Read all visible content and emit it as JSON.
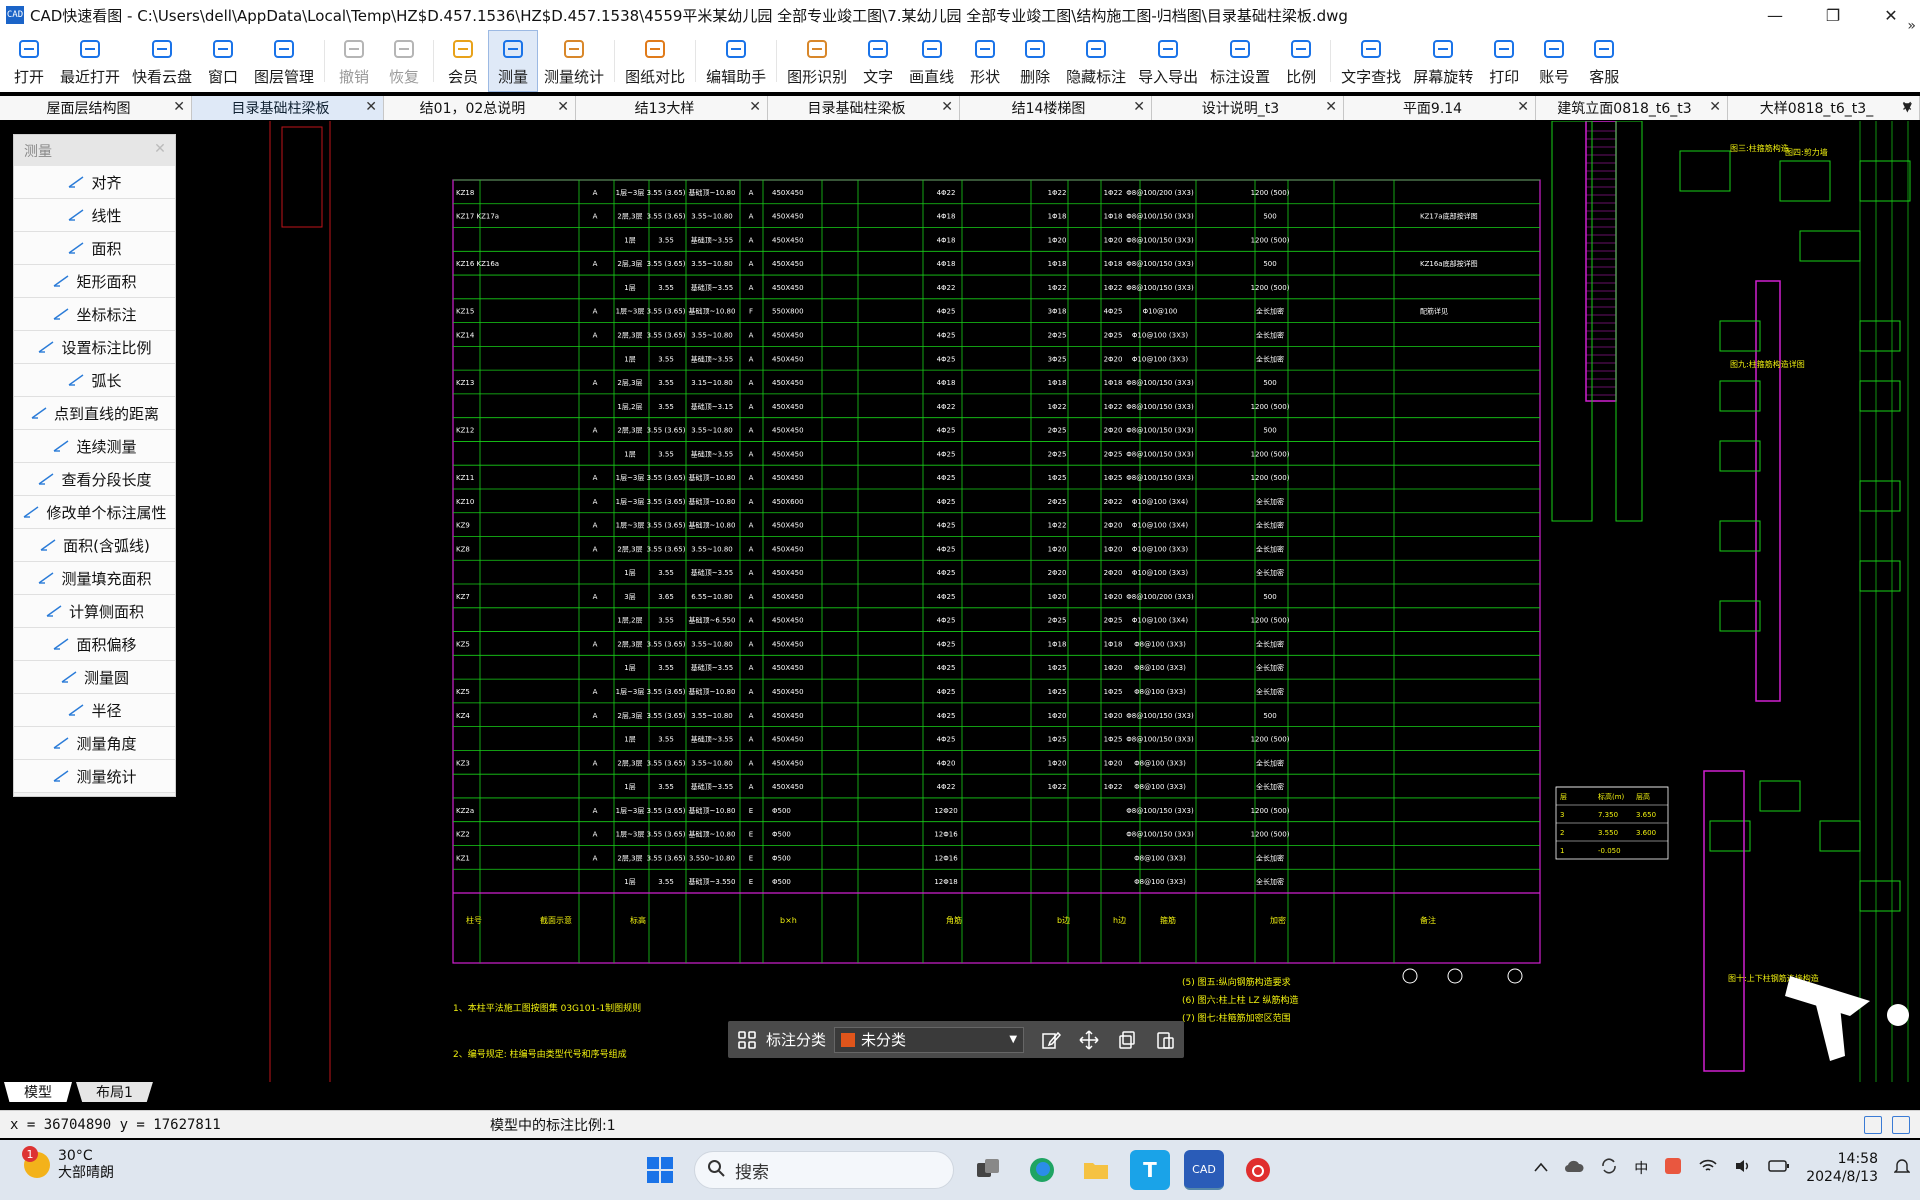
{
  "window": {
    "title": "CAD快速看图 - C:\\Users\\dell\\AppData\\Local\\Temp\\HZ$D.457.1536\\HZ$D.457.1538\\4559平米某幼儿园 全部专业竣工图\\7.某幼儿园 全部专业竣工图\\结构施工图-归档图\\目录基础柱梁板.dwg",
    "app_icon_text": "CAD",
    "controls": {
      "minimize": "—",
      "restore": "❐",
      "close": "✕"
    }
  },
  "toolbar": {
    "items": [
      {
        "label": "打开",
        "icon": "folder-open-icon",
        "state": "normal"
      },
      {
        "label": "最近打开",
        "icon": "recent-clock-icon",
        "state": "normal"
      },
      {
        "label": "快看云盘",
        "icon": "cloud-icon",
        "state": "normal"
      },
      {
        "label": "窗口",
        "icon": "window-icon",
        "state": "normal"
      },
      {
        "label": "图层管理",
        "icon": "layers-icon",
        "state": "normal"
      },
      {
        "label": "撤销",
        "icon": "undo-icon",
        "state": "disabled"
      },
      {
        "label": "恢复",
        "icon": "redo-icon",
        "state": "disabled"
      },
      {
        "label": "会员",
        "icon": "vip-icon",
        "state": "normal"
      },
      {
        "label": "测量",
        "icon": "ruler-icon",
        "state": "active"
      },
      {
        "label": "测量统计",
        "icon": "measure-stats-icon",
        "state": "normal"
      },
      {
        "label": "图纸对比",
        "icon": "compare-icon",
        "state": "normal"
      },
      {
        "label": "编辑助手",
        "icon": "cad-edit-icon",
        "state": "normal"
      },
      {
        "label": "图形识别",
        "icon": "shape-recognize-icon",
        "state": "normal"
      },
      {
        "label": "文字",
        "icon": "text-icon",
        "state": "normal"
      },
      {
        "label": "画直线",
        "icon": "line-icon",
        "state": "normal"
      },
      {
        "label": "形状",
        "icon": "shape-icon",
        "state": "normal"
      },
      {
        "label": "删除",
        "icon": "eraser-icon",
        "state": "normal"
      },
      {
        "label": "隐藏标注",
        "icon": "hide-eye-icon",
        "state": "normal"
      },
      {
        "label": "导入导出",
        "icon": "import-export-icon",
        "state": "normal"
      },
      {
        "label": "标注设置",
        "icon": "annotation-settings-icon",
        "state": "normal"
      },
      {
        "label": "比例",
        "icon": "scale-icon",
        "state": "normal"
      },
      {
        "label": "文字查找",
        "icon": "text-search-icon",
        "state": "normal"
      },
      {
        "label": "屏幕旋转",
        "icon": "rotate-screen-icon",
        "state": "normal"
      },
      {
        "label": "打印",
        "icon": "print-icon",
        "state": "normal"
      },
      {
        "label": "账号",
        "icon": "account-icon",
        "state": "normal"
      },
      {
        "label": "客服",
        "icon": "headset-icon",
        "state": "normal"
      }
    ],
    "more": "»"
  },
  "tabs": [
    {
      "label": "屋面层结构图",
      "active": false
    },
    {
      "label": "目录基础柱梁板",
      "active": true
    },
    {
      "label": "结01，02总说明",
      "active": false
    },
    {
      "label": "结13大样",
      "active": false
    },
    {
      "label": "目录基础柱梁板",
      "active": false
    },
    {
      "label": "结14楼梯图",
      "active": false
    },
    {
      "label": "设计说明_t3",
      "active": false
    },
    {
      "label": "平面9.14",
      "active": false
    },
    {
      "label": "建筑立面0818_t6_t3",
      "active": false
    },
    {
      "label": "大样0818_t6_t3_",
      "active": false
    }
  ],
  "tabs_close": "✕",
  "tabs_overflow": "▼",
  "measure_panel": {
    "title": "测量",
    "close": "✕",
    "items": [
      {
        "label": "对齐",
        "icon": "align-measure-icon"
      },
      {
        "label": "线性",
        "icon": "linear-measure-icon"
      },
      {
        "label": "面积",
        "icon": "area-icon"
      },
      {
        "label": "矩形面积",
        "icon": "rect-area-icon"
      },
      {
        "label": "坐标标注",
        "icon": "coordinate-icon"
      },
      {
        "label": "设置标注比例",
        "icon": "scale-setting-icon"
      },
      {
        "label": "弧长",
        "icon": "arc-length-icon"
      },
      {
        "label": "点到直线的距离",
        "icon": "point-line-distance-icon"
      },
      {
        "label": "连续测量",
        "icon": "continuous-measure-icon"
      },
      {
        "label": "查看分段长度",
        "icon": "segment-length-icon"
      },
      {
        "label": "修改单个标注属性",
        "icon": "edit-annotation-icon"
      },
      {
        "label": "面积(含弧线)",
        "icon": "arc-area-icon"
      },
      {
        "label": "测量填充面积",
        "icon": "fill-area-icon"
      },
      {
        "label": "计算侧面积",
        "icon": "side-area-icon"
      },
      {
        "label": "面积偏移",
        "icon": "area-offset-icon"
      },
      {
        "label": "测量圆",
        "icon": "circle-measure-icon"
      },
      {
        "label": "半径",
        "icon": "radius-icon"
      },
      {
        "label": "测量角度",
        "icon": "angle-icon"
      },
      {
        "label": "测量统计",
        "icon": "stats-icon"
      }
    ]
  },
  "drawing": {
    "table_rows": [
      {
        "id": "KZ18",
        "col1": "A",
        "floor": "1层~3层",
        "h": "3.55 (3.65)",
        "elev": "基础顶~10.80",
        "sec": "A",
        "bxh": "450X450",
        "corner": "4Φ22",
        "b1": "1Φ22",
        "h1": "1Φ22",
        "stir": "Φ8@100/200 (3X3)",
        "len": "1200 (500)",
        "note": ""
      },
      {
        "id": "KZ17 KZ17a",
        "col1": "A",
        "floor": "2层,3层",
        "h": "3.55 (3.65)",
        "elev": "3.55~10.80",
        "sec": "A",
        "bxh": "450X450",
        "corner": "4Φ18",
        "b1": "1Φ18",
        "h1": "1Φ18",
        "stir": "Φ8@100/150 (3X3)",
        "len": "500",
        "note": "KZ17a底部按详图"
      },
      {
        "id": "",
        "col1": "",
        "floor": "1层",
        "h": "3.55",
        "elev": "基础顶~3.55",
        "sec": "A",
        "bxh": "450X450",
        "corner": "4Φ18",
        "b1": "1Φ20",
        "h1": "1Φ20",
        "stir": "Φ8@100/150 (3X3)",
        "len": "1200 (500)",
        "note": ""
      },
      {
        "id": "KZ16 KZ16a",
        "col1": "A",
        "floor": "2层,3层",
        "h": "3.55 (3.65)",
        "elev": "3.55~10.80",
        "sec": "A",
        "bxh": "450X450",
        "corner": "4Φ18",
        "b1": "1Φ18",
        "h1": "1Φ18",
        "stir": "Φ8@100/150 (3X3)",
        "len": "500",
        "note": "KZ16a底部按详图"
      },
      {
        "id": "",
        "col1": "",
        "floor": "1层",
        "h": "3.55",
        "elev": "基础顶~3.55",
        "sec": "A",
        "bxh": "450X450",
        "corner": "4Φ22",
        "b1": "1Φ22",
        "h1": "1Φ22",
        "stir": "Φ8@100/150 (3X3)",
        "len": "1200 (500)",
        "note": ""
      },
      {
        "id": "KZ15",
        "col1": "A",
        "floor": "1层~3层",
        "h": "3.55 (3.65)",
        "elev": "基础顶~10.80",
        "sec": "F",
        "bxh": "550X800",
        "corner": "4Φ25",
        "b1": "3Φ18",
        "h1": "4Φ25",
        "stir": "Φ10@100",
        "len": "全长加密",
        "note": "配筋详见"
      },
      {
        "id": "KZ14",
        "col1": "A",
        "floor": "2层,3层",
        "h": "3.55 (3.65)",
        "elev": "3.55~10.80",
        "sec": "A",
        "bxh": "450X450",
        "corner": "4Φ25",
        "b1": "2Φ25",
        "h1": "2Φ25",
        "stir": "Φ10@100 (3X3)",
        "len": "全长加密",
        "note": ""
      },
      {
        "id": "",
        "col1": "",
        "floor": "1层",
        "h": "3.55",
        "elev": "基础顶~3.55",
        "sec": "A",
        "bxh": "450X450",
        "corner": "4Φ25",
        "b1": "3Φ25",
        "h1": "2Φ20",
        "stir": "Φ10@100 (3X3)",
        "len": "全长加密",
        "note": ""
      },
      {
        "id": "KZ13",
        "col1": "A",
        "floor": "2层,3层",
        "h": "3.55",
        "elev": "3.15~10.80",
        "sec": "A",
        "bxh": "450X450",
        "corner": "4Φ18",
        "b1": "1Φ18",
        "h1": "1Φ18",
        "stir": "Φ8@100/150 (3X3)",
        "len": "500",
        "note": ""
      },
      {
        "id": "",
        "col1": "",
        "floor": "1层,2层",
        "h": "3.55",
        "elev": "基础顶~3.15",
        "sec": "A",
        "bxh": "450X450",
        "corner": "4Φ22",
        "b1": "1Φ22",
        "h1": "1Φ22",
        "stir": "Φ8@100/150 (3X3)",
        "len": "1200 (500)",
        "note": ""
      },
      {
        "id": "KZ12",
        "col1": "A",
        "floor": "2层,3层",
        "h": "3.55 (3.65)",
        "elev": "3.55~10.80",
        "sec": "A",
        "bxh": "450X450",
        "corner": "4Φ25",
        "b1": "2Φ25",
        "h1": "2Φ20",
        "stir": "Φ8@100/150 (3X3)",
        "len": "500",
        "note": ""
      },
      {
        "id": "",
        "col1": "",
        "floor": "1层",
        "h": "3.55",
        "elev": "基础顶~3.55",
        "sec": "A",
        "bxh": "450X450",
        "corner": "4Φ25",
        "b1": "2Φ25",
        "h1": "2Φ25",
        "stir": "Φ8@100/150 (3X3)",
        "len": "1200 (500)",
        "note": ""
      },
      {
        "id": "KZ11",
        "col1": "A",
        "floor": "1层~3层",
        "h": "3.55 (3.65)",
        "elev": "基础顶~10.80",
        "sec": "A",
        "bxh": "450X450",
        "corner": "4Φ25",
        "b1": "1Φ25",
        "h1": "1Φ25",
        "stir": "Φ8@100/150 (3X3)",
        "len": "1200 (500)",
        "note": ""
      },
      {
        "id": "KZ10",
        "col1": "A",
        "floor": "1层~3层",
        "h": "3.55 (3.65)",
        "elev": "基础顶~10.80",
        "sec": "A",
        "bxh": "450X600",
        "corner": "4Φ25",
        "b1": "2Φ25",
        "h1": "2Φ22",
        "stir": "Φ10@100 (3X4)",
        "len": "全长加密",
        "note": ""
      },
      {
        "id": "KZ9",
        "col1": "A",
        "floor": "1层~3层",
        "h": "3.55 (3.65)",
        "elev": "基础顶~10.80",
        "sec": "A",
        "bxh": "450X450",
        "corner": "4Φ25",
        "b1": "1Φ22",
        "h1": "2Φ20",
        "stir": "Φ10@100 (3X4)",
        "len": "全长加密",
        "note": ""
      },
      {
        "id": "KZ8",
        "col1": "A",
        "floor": "2层,3层",
        "h": "3.55 (3.65)",
        "elev": "3.55~10.80",
        "sec": "A",
        "bxh": "450X450",
        "corner": "4Φ25",
        "b1": "1Φ20",
        "h1": "1Φ20",
        "stir": "Φ10@100 (3X3)",
        "len": "全长加密",
        "note": ""
      },
      {
        "id": "",
        "col1": "",
        "floor": "1层",
        "h": "3.55",
        "elev": "基础顶~3.55",
        "sec": "A",
        "bxh": "450X450",
        "corner": "4Φ25",
        "b1": "2Φ20",
        "h1": "2Φ20",
        "stir": "Φ10@100 (3X3)",
        "len": "全长加密",
        "note": ""
      },
      {
        "id": "KZ7",
        "col1": "A",
        "floor": "3层",
        "h": "3.65",
        "elev": "6.55~10.80",
        "sec": "A",
        "bxh": "450X450",
        "corner": "4Φ25",
        "b1": "1Φ20",
        "h1": "1Φ20",
        "stir": "Φ8@100/200 (3X3)",
        "len": "500",
        "note": ""
      },
      {
        "id": "",
        "col1": "",
        "floor": "1层,2层",
        "h": "3.55",
        "elev": "基础顶~6.550",
        "sec": "A",
        "bxh": "450X450",
        "corner": "4Φ25",
        "b1": "2Φ25",
        "h1": "2Φ25",
        "stir": "Φ10@100 (3X4)",
        "len": "1200 (500)",
        "note": ""
      },
      {
        "id": "KZ5",
        "col1": "A",
        "floor": "2层,3层",
        "h": "3.55 (3.65)",
        "elev": "3.55~10.80",
        "sec": "A",
        "bxh": "450X450",
        "corner": "4Φ25",
        "b1": "1Φ18",
        "h1": "1Φ18",
        "stir": "Φ8@100 (3X3)",
        "len": "全长加密",
        "note": ""
      },
      {
        "id": "",
        "col1": "",
        "floor": "1层",
        "h": "3.55",
        "elev": "基础顶~3.55",
        "sec": "A",
        "bxh": "450X450",
        "corner": "4Φ25",
        "b1": "1Φ25",
        "h1": "1Φ20",
        "stir": "Φ8@100 (3X3)",
        "len": "全长加密",
        "note": ""
      },
      {
        "id": "KZ5",
        "col1": "A",
        "floor": "1层~3层",
        "h": "3.55 (3.65)",
        "elev": "基础顶~10.80",
        "sec": "A",
        "bxh": "450X450",
        "corner": "4Φ25",
        "b1": "1Φ25",
        "h1": "1Φ25",
        "stir": "Φ8@100 (3X3)",
        "len": "全长加密",
        "note": ""
      },
      {
        "id": "KZ4",
        "col1": "A",
        "floor": "2层,3层",
        "h": "3.55 (3.65)",
        "elev": "3.55~10.80",
        "sec": "A",
        "bxh": "450X450",
        "corner": "4Φ25",
        "b1": "1Φ20",
        "h1": "1Φ20",
        "stir": "Φ8@100/150 (3X3)",
        "len": "500",
        "note": ""
      },
      {
        "id": "",
        "col1": "",
        "floor": "1层",
        "h": "3.55",
        "elev": "基础顶~3.55",
        "sec": "A",
        "bxh": "450X450",
        "corner": "4Φ25",
        "b1": "1Φ25",
        "h1": "1Φ25",
        "stir": "Φ8@100/150 (3X3)",
        "len": "1200 (500)",
        "note": ""
      },
      {
        "id": "KZ3",
        "col1": "A",
        "floor": "2层,3层",
        "h": "3.55 (3.65)",
        "elev": "3.55~10.80",
        "sec": "A",
        "bxh": "450X450",
        "corner": "4Φ20",
        "b1": "1Φ20",
        "h1": "1Φ20",
        "stir": "Φ8@100 (3X3)",
        "len": "全长加密",
        "note": ""
      },
      {
        "id": "",
        "col1": "",
        "floor": "1层",
        "h": "3.55",
        "elev": "基础顶~3.55",
        "sec": "A",
        "bxh": "450X450",
        "corner": "4Φ22",
        "b1": "1Φ22",
        "h1": "1Φ22",
        "stir": "Φ8@100 (3X3)",
        "len": "全长加密",
        "note": ""
      },
      {
        "id": "KZ2a",
        "col1": "A",
        "floor": "1层~3层",
        "h": "3.55 (3.65)",
        "elev": "基础顶~10.80",
        "sec": "E",
        "bxh": "Φ500",
        "corner": "12Φ20",
        "b1": "",
        "h1": "",
        "stir": "Φ8@100/150 (3X3)",
        "len": "1200 (500)",
        "note": ""
      },
      {
        "id": "KZ2",
        "col1": "A",
        "floor": "1层~3层",
        "h": "3.55 (3.65)",
        "elev": "基础顶~10.80",
        "sec": "E",
        "bxh": "Φ500",
        "corner": "12Φ16",
        "b1": "",
        "h1": "",
        "stir": "Φ8@100/150 (3X3)",
        "len": "1200 (500)",
        "note": ""
      },
      {
        "id": "KZ1",
        "col1": "A",
        "floor": "2层,3层",
        "h": "3.55 (3.65)",
        "elev": "3.550~10.80",
        "sec": "E",
        "bxh": "Φ500",
        "corner": "12Φ16",
        "b1": "",
        "h1": "",
        "stir": "Φ8@100 (3X3)",
        "len": "全长加密",
        "note": ""
      },
      {
        "id": "",
        "col1": "",
        "floor": "1层",
        "h": "3.55",
        "elev": "基础顶~3.550",
        "sec": "E",
        "bxh": "Φ500",
        "corner": "12Φ18",
        "b1": "",
        "h1": "",
        "stir": "Φ8@100 (3X3)",
        "len": "全长加密",
        "note": ""
      }
    ],
    "footer_headers": [
      "柱号",
      "截面示意",
      "标高",
      "b×h",
      "角筋",
      "b边",
      "h边",
      "箍筋",
      "加密",
      "备注"
    ],
    "notes_left": [
      "1、本柱平法施工图按图集 03G101-1制图规则",
      "2、编号规定: 柱编号由类型代号和序号组成"
    ],
    "notes_mid": [
      "(5) 图五:纵向钢筋构造要求",
      "(6) 图六:柱上柱 LZ 纵筋构造",
      "(7) 图七:柱箍筋加密区范围"
    ],
    "side_labels": [
      "图三:柱箍筋构造",
      "图四:剪力墙",
      "图九:柱箍筋构造详图",
      "图十:上下柱钢筋连接构造"
    ],
    "small_table": [
      [
        "层",
        "标高(m)",
        "层高"
      ],
      [
        "3",
        "7.350",
        "3.650"
      ],
      [
        "2",
        "3.550",
        "3.600"
      ],
      [
        "1",
        "-0.050",
        ""
      ]
    ]
  },
  "annotation_bar": {
    "label": "标注分类",
    "category": "未分类",
    "category_color": "#e0551b"
  },
  "layout_tabs": [
    {
      "label": "模型",
      "active": true
    },
    {
      "label": "布局1",
      "active": false
    }
  ],
  "status": {
    "coords": "x = 36704890  y = 17627811",
    "scale_text": "模型中的标注比例:1"
  },
  "taskbar": {
    "weather_badge": "1",
    "temperature": "30°C",
    "weather_text": "大部晴朗",
    "search_placeholder": "搜索",
    "ime": "中",
    "time": "14:58",
    "date": "2024/8/13"
  }
}
